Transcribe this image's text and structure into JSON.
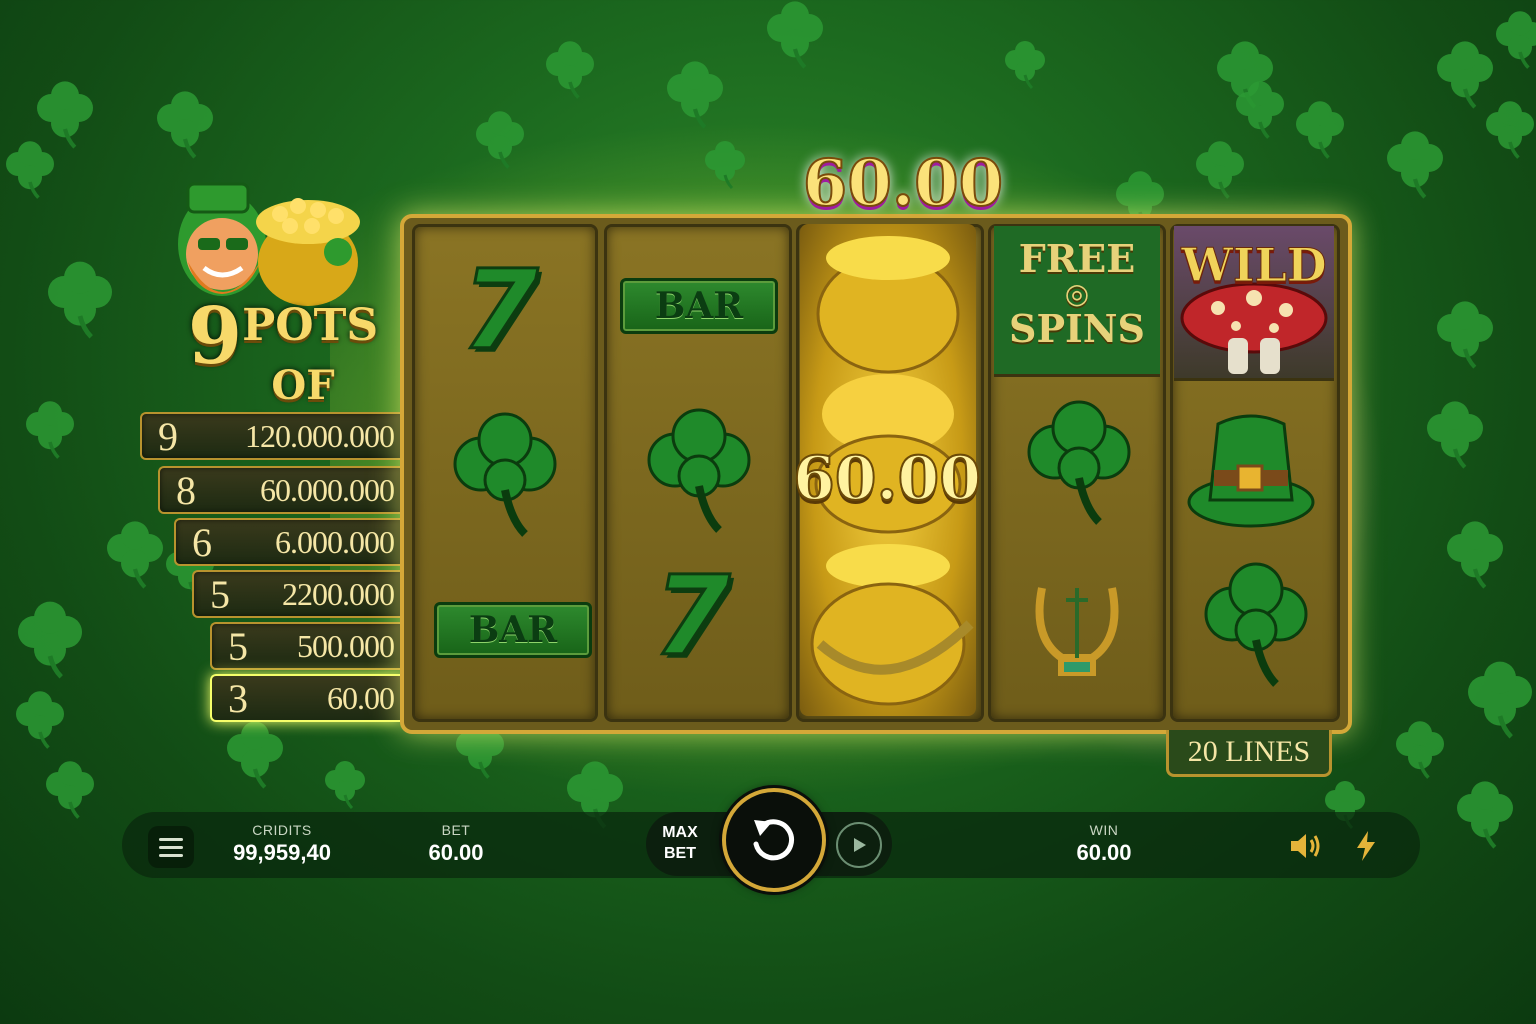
{
  "game": {
    "logo": {
      "number": "9",
      "line1": "POTS",
      "line2": "OF GOLD"
    },
    "jackpots": [
      {
        "count": "9",
        "value": "120.000.000",
        "active": false
      },
      {
        "count": "8",
        "value": "60.000.000",
        "active": false
      },
      {
        "count": "6",
        "value": "6.000.000",
        "active": false
      },
      {
        "count": "5",
        "value": "2200.000",
        "active": false
      },
      {
        "count": "5",
        "value": "500.000",
        "active": false
      },
      {
        "count": "3",
        "value": "60.00",
        "active": true
      }
    ],
    "reels": {
      "reel1": [
        "seven",
        "clover",
        "bar"
      ],
      "reel2": [
        "bar",
        "clover",
        "seven"
      ],
      "reel3": [
        "pot-of-gold",
        "pot-of-gold",
        "pot-of-gold"
      ],
      "reel4": [
        "free-spins",
        "clover",
        "lyre"
      ],
      "reel5": [
        "wild-mushroom",
        "leprechaun-hat",
        "clover"
      ]
    },
    "symbol_text": {
      "bar": "BAR",
      "seven": "7",
      "free_spins": "FREE\nSPINS",
      "wild": "WILD"
    },
    "win_amount_top": "60.00",
    "win_amount_reel": "60.00",
    "lines": "20 LINES"
  },
  "bottom_bar": {
    "credits_label": "CRIDITS",
    "credits_value": "99,959,40",
    "bet_label": "BET",
    "bet_value": "60.00",
    "max_bet_line1": "MAX",
    "max_bet_line2": "BET",
    "win_label": "WIN",
    "win_value": "60.00"
  },
  "colors": {
    "gold": "#d4a838",
    "clover_green": "#1f8a2a",
    "background": "#1c6a1f",
    "highlight": "#f6ff6a"
  },
  "icons": [
    "menu-icon",
    "spin-icon",
    "autoplay-icon",
    "sound-icon",
    "turbo-icon"
  ]
}
